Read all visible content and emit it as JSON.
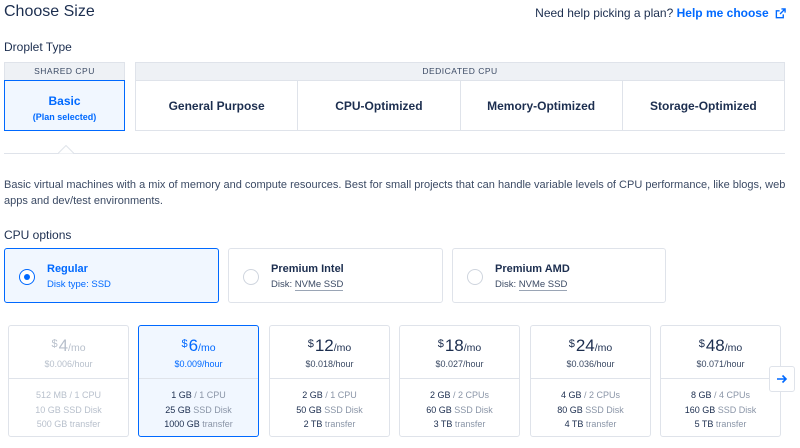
{
  "header": {
    "title": "Choose Size",
    "help_text": "Need help picking a plan?",
    "help_link": "Help me choose"
  },
  "droplet_type": {
    "label": "Droplet Type",
    "shared_head": "SHARED CPU",
    "dedicated_head": "DEDICATED CPU",
    "basic_label": "Basic",
    "basic_sub": "(Plan selected)",
    "dedicated_options": [
      "General Purpose",
      "CPU-Optimized",
      "Memory-Optimized",
      "Storage-Optimized"
    ]
  },
  "description": "Basic virtual machines with a mix of memory and compute resources. Best for small projects that can handle variable levels of CPU performance, like blogs, web apps and dev/test environments.",
  "cpu_options": {
    "label": "CPU options",
    "items": [
      {
        "name": "Regular",
        "disk_prefix": "Disk type: ",
        "disk": "SSD"
      },
      {
        "name": "Premium Intel",
        "disk_prefix": "Disk: ",
        "disk": "NVMe SSD"
      },
      {
        "name": "Premium AMD",
        "disk_prefix": "Disk: ",
        "disk": "NVMe SSD"
      }
    ]
  },
  "plans": [
    {
      "currency": "$",
      "price": "4",
      "unit": "/mo",
      "hourly": "$0.006",
      "hour_unit": "/hour",
      "ram": "512 MB",
      "cpu": "1 CPU",
      "disk_size": "10 GB",
      "disk_type": "SSD Disk",
      "transfer": "500 GB",
      "transfer_label": "transfer"
    },
    {
      "currency": "$",
      "price": "6",
      "unit": "/mo",
      "hourly": "$0.009",
      "hour_unit": "/hour",
      "ram": "1 GB",
      "cpu": "1 CPU",
      "disk_size": "25 GB",
      "disk_type": "SSD Disk",
      "transfer": "1000 GB",
      "transfer_label": "transfer"
    },
    {
      "currency": "$",
      "price": "12",
      "unit": "/mo",
      "hourly": "$0.018",
      "hour_unit": "/hour",
      "ram": "2 GB",
      "cpu": "1 CPU",
      "disk_size": "50 GB",
      "disk_type": "SSD Disk",
      "transfer": "2 TB",
      "transfer_label": "transfer"
    },
    {
      "currency": "$",
      "price": "18",
      "unit": "/mo",
      "hourly": "$0.027",
      "hour_unit": "/hour",
      "ram": "2 GB",
      "cpu": "2 CPUs",
      "disk_size": "60 GB",
      "disk_type": "SSD Disk",
      "transfer": "3 TB",
      "transfer_label": "transfer"
    },
    {
      "currency": "$",
      "price": "24",
      "unit": "/mo",
      "hourly": "$0.036",
      "hour_unit": "/hour",
      "ram": "4 GB",
      "cpu": "2 CPUs",
      "disk_size": "80 GB",
      "disk_type": "SSD Disk",
      "transfer": "4 TB",
      "transfer_label": "transfer"
    },
    {
      "currency": "$",
      "price": "48",
      "unit": "/mo",
      "hourly": "$0.071",
      "hour_unit": "/hour",
      "ram": "8 GB",
      "cpu": "4 CPUs",
      "disk_size": "160 GB",
      "disk_type": "SSD Disk",
      "transfer": "5 TB",
      "transfer_label": "transfer"
    }
  ],
  "icons": {
    "help_external": "external-link-icon",
    "next": "arrow-right-icon"
  },
  "colors": {
    "accent": "#0069ff",
    "selected_bg": "#f1f7ff",
    "border": "#dfe3ea"
  }
}
